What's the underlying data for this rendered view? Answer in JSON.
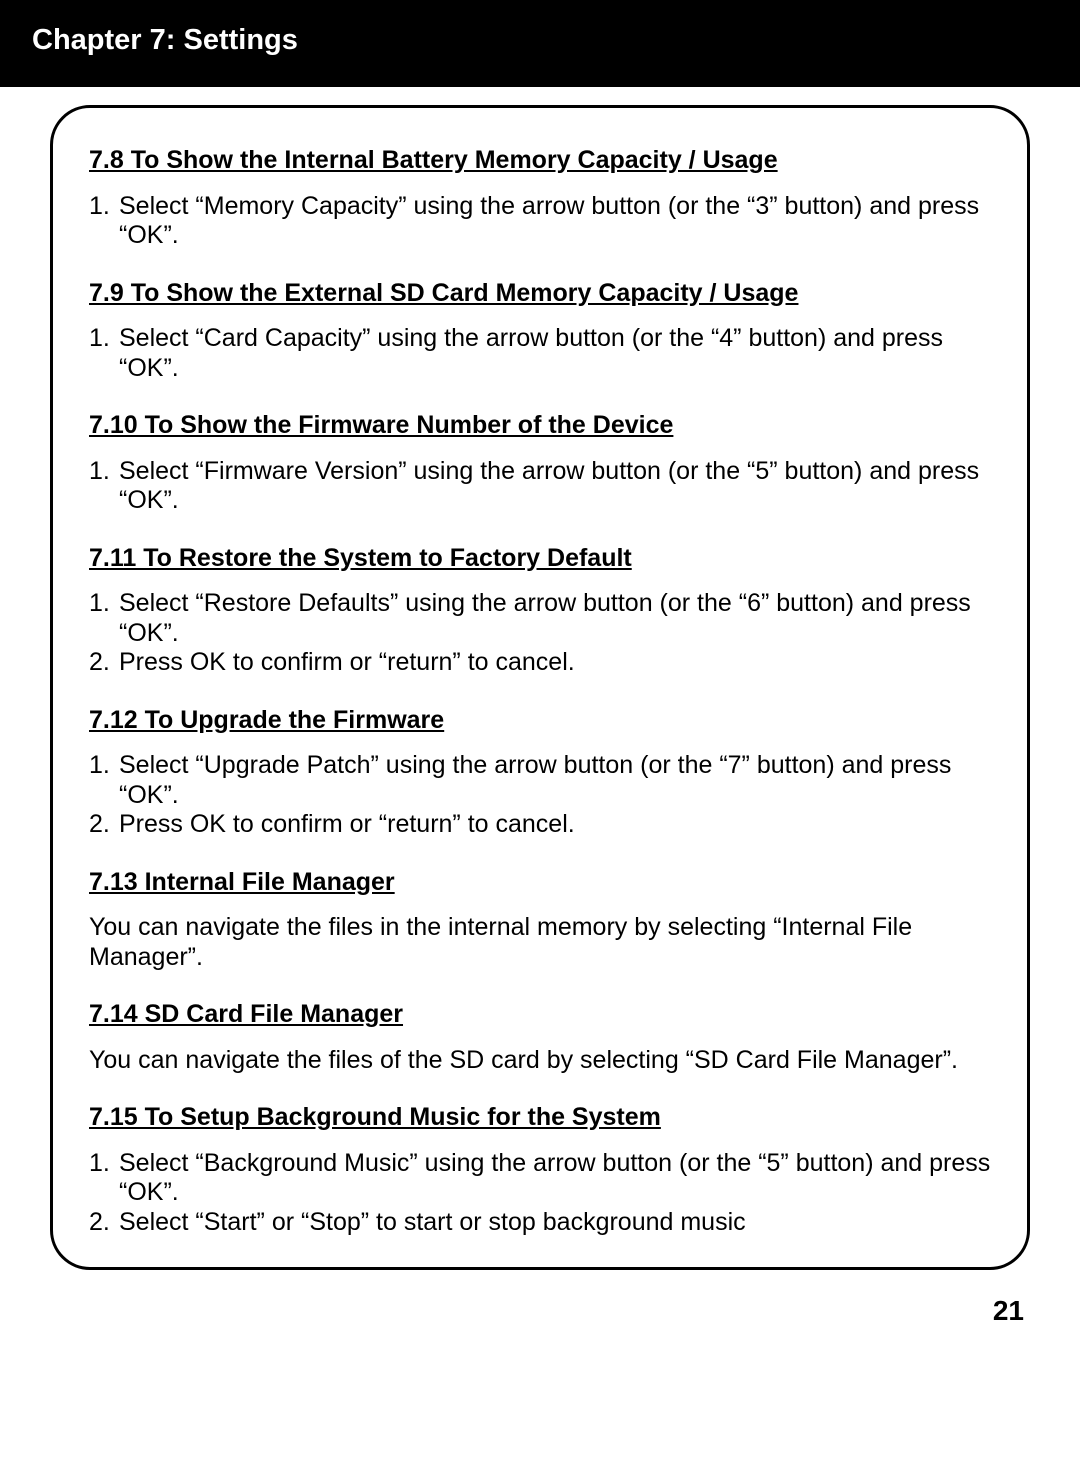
{
  "header": {
    "title": "Chapter 7: Settings"
  },
  "sections": {
    "s7_8": {
      "heading": "7.8 To Show the Internal Battery Memory Capacity / Usage",
      "step1": "Select “Memory Capacity” using the arrow button (or the “3” button) and press “OK”."
    },
    "s7_9": {
      "heading": "7.9 To Show the External SD Card Memory Capacity / Usage",
      "step1": "Select “Card Capacity” using the arrow button (or the “4” button) and press “OK”."
    },
    "s7_10": {
      "heading": "7.10 To Show the Firmware Number of the Device",
      "step1": "Select “Firmware Version” using the arrow button (or the “5” button) and press “OK”."
    },
    "s7_11": {
      "heading": "7.11 To Restore the System to Factory Default",
      "step1": "Select “Restore Defaults” using the arrow button (or the “6” button) and press “OK”.",
      "step2": "Press OK to confirm or “return” to cancel."
    },
    "s7_12": {
      "heading": "7.12 To Upgrade the Firmware",
      "step1": "Select “Upgrade Patch” using the arrow button (or the “7” button) and press “OK”.",
      "step2": "Press OK to confirm or “return” to cancel."
    },
    "s7_13": {
      "heading": "7.13 Internal File Manager",
      "para": "You can navigate the files in the internal memory by selecting “Internal File Manager”."
    },
    "s7_14": {
      "heading": "7.14 SD Card File Manager",
      "para": "You can navigate the files of the SD card by selecting “SD Card File Manager”."
    },
    "s7_15": {
      "heading": "7.15 To Setup Background Music for the System",
      "step1": "Select “Background Music” using the arrow button (or the “5” button) and press “OK”.",
      "step2": "Select “Start” or “Stop” to start or stop background music"
    }
  },
  "page_number": "21"
}
